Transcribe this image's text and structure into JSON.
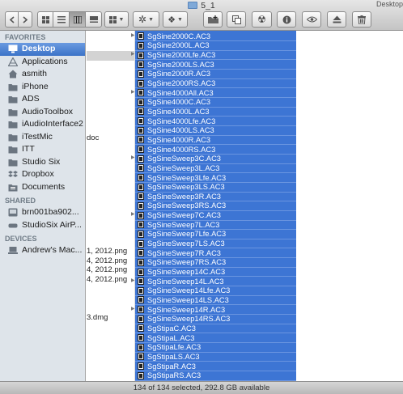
{
  "window": {
    "title": "5_1",
    "top_right_fragment": "Desktop"
  },
  "toolbar": {
    "back_icon": "chevron-left-icon",
    "forward_icon": "chevron-right-icon",
    "view_icons": [
      "icon-view-icon",
      "list-view-icon",
      "column-view-icon",
      "coverflow-view-icon"
    ],
    "arrange_icon": "arrange-grid-icon",
    "action_icon": "gear-icon",
    "share_icon": "dropbox-icon",
    "new_folder_icon": "new-folder-icon",
    "buttons": [
      "copy-icon",
      "radioactive-icon",
      "info-icon",
      "quicklook-eye-icon",
      "eject-icon",
      "trash-icon"
    ]
  },
  "sidebar": {
    "favorites_header": "FAVORITES",
    "favorites": [
      {
        "label": "Desktop",
        "icon": "desktop-icon",
        "selected": true
      },
      {
        "label": "Applications",
        "icon": "applications-icon",
        "selected": false
      },
      {
        "label": "asmith",
        "icon": "home-icon",
        "selected": false
      },
      {
        "label": "iPhone",
        "icon": "folder-icon",
        "selected": false
      },
      {
        "label": "ADS",
        "icon": "folder-icon",
        "selected": false
      },
      {
        "label": "AudioToolbox",
        "icon": "folder-icon",
        "selected": false
      },
      {
        "label": "iAudioInterface2",
        "icon": "folder-icon",
        "selected": false
      },
      {
        "label": "iTestMic",
        "icon": "folder-icon",
        "selected": false
      },
      {
        "label": "ITT",
        "icon": "folder-icon",
        "selected": false
      },
      {
        "label": "Studio Six",
        "icon": "folder-icon",
        "selected": false
      },
      {
        "label": "Dropbox",
        "icon": "dropbox-icon",
        "selected": false
      },
      {
        "label": "Documents",
        "icon": "documents-icon",
        "selected": false
      }
    ],
    "shared_header": "SHARED",
    "shared": [
      {
        "label": "brn001ba902...",
        "icon": "printer-server-icon"
      },
      {
        "label": "StudioSix AirP...",
        "icon": "airport-icon"
      }
    ],
    "devices_header": "DEVICES",
    "devices": [
      {
        "label": "Andrew's Mac...",
        "icon": "laptop-icon"
      }
    ]
  },
  "middle_column": {
    "fragments": [
      {
        "text": "doc",
        "row": 11
      },
      {
        "text": "1, 2012.png",
        "row": 23
      },
      {
        "text": "4, 2012.png",
        "row": 24
      },
      {
        "text": "4, 2012.png",
        "row": 25
      },
      {
        "text": "4, 2012.png",
        "row": 26
      },
      {
        "text": "3.dmg",
        "row": 30
      }
    ]
  },
  "files": [
    "SgSine2000C.AC3",
    "SgSine2000L.AC3",
    "SgSine2000Lfe.AC3",
    "SgSine2000LS.AC3",
    "SgSine2000R.AC3",
    "SgSine2000RS.AC3",
    "SgSine4000All.AC3",
    "SgSine4000C.AC3",
    "SgSine4000L.AC3",
    "SgSine4000Lfe.AC3",
    "SgSine4000LS.AC3",
    "SgSine4000R.AC3",
    "SgSine4000RS.AC3",
    "SgSineSweep3C.AC3",
    "SgSineSweep3L.AC3",
    "SgSineSweep3Lfe.AC3",
    "SgSineSweep3LS.AC3",
    "SgSineSweep3R.AC3",
    "SgSineSweep3RS.AC3",
    "SgSineSweep7C.AC3",
    "SgSineSweep7L.AC3",
    "SgSineSweep7Lfe.AC3",
    "SgSineSweep7LS.AC3",
    "SgSineSweep7R.AC3",
    "SgSineSweep7RS.AC3",
    "SgSineSweep14C.AC3",
    "SgSineSweep14L.AC3",
    "SgSineSweep14Lfe.AC3",
    "SgSineSweep14LS.AC3",
    "SgSineSweep14R.AC3",
    "SgSineSweep14RS.AC3",
    "SgStipaC.AC3",
    "SgStipaL.AC3",
    "SgStipaLfe.AC3",
    "SgStipaLS.AC3",
    "SgStipaR.AC3",
    "SgStipaRS.AC3"
  ],
  "status": {
    "text": "134 of 134 selected, 292.8 GB available"
  },
  "colors": {
    "selection": "#3d75d4",
    "sidebar_bg": "#dee4ea",
    "sidebar_selected": "#3b73c8"
  }
}
